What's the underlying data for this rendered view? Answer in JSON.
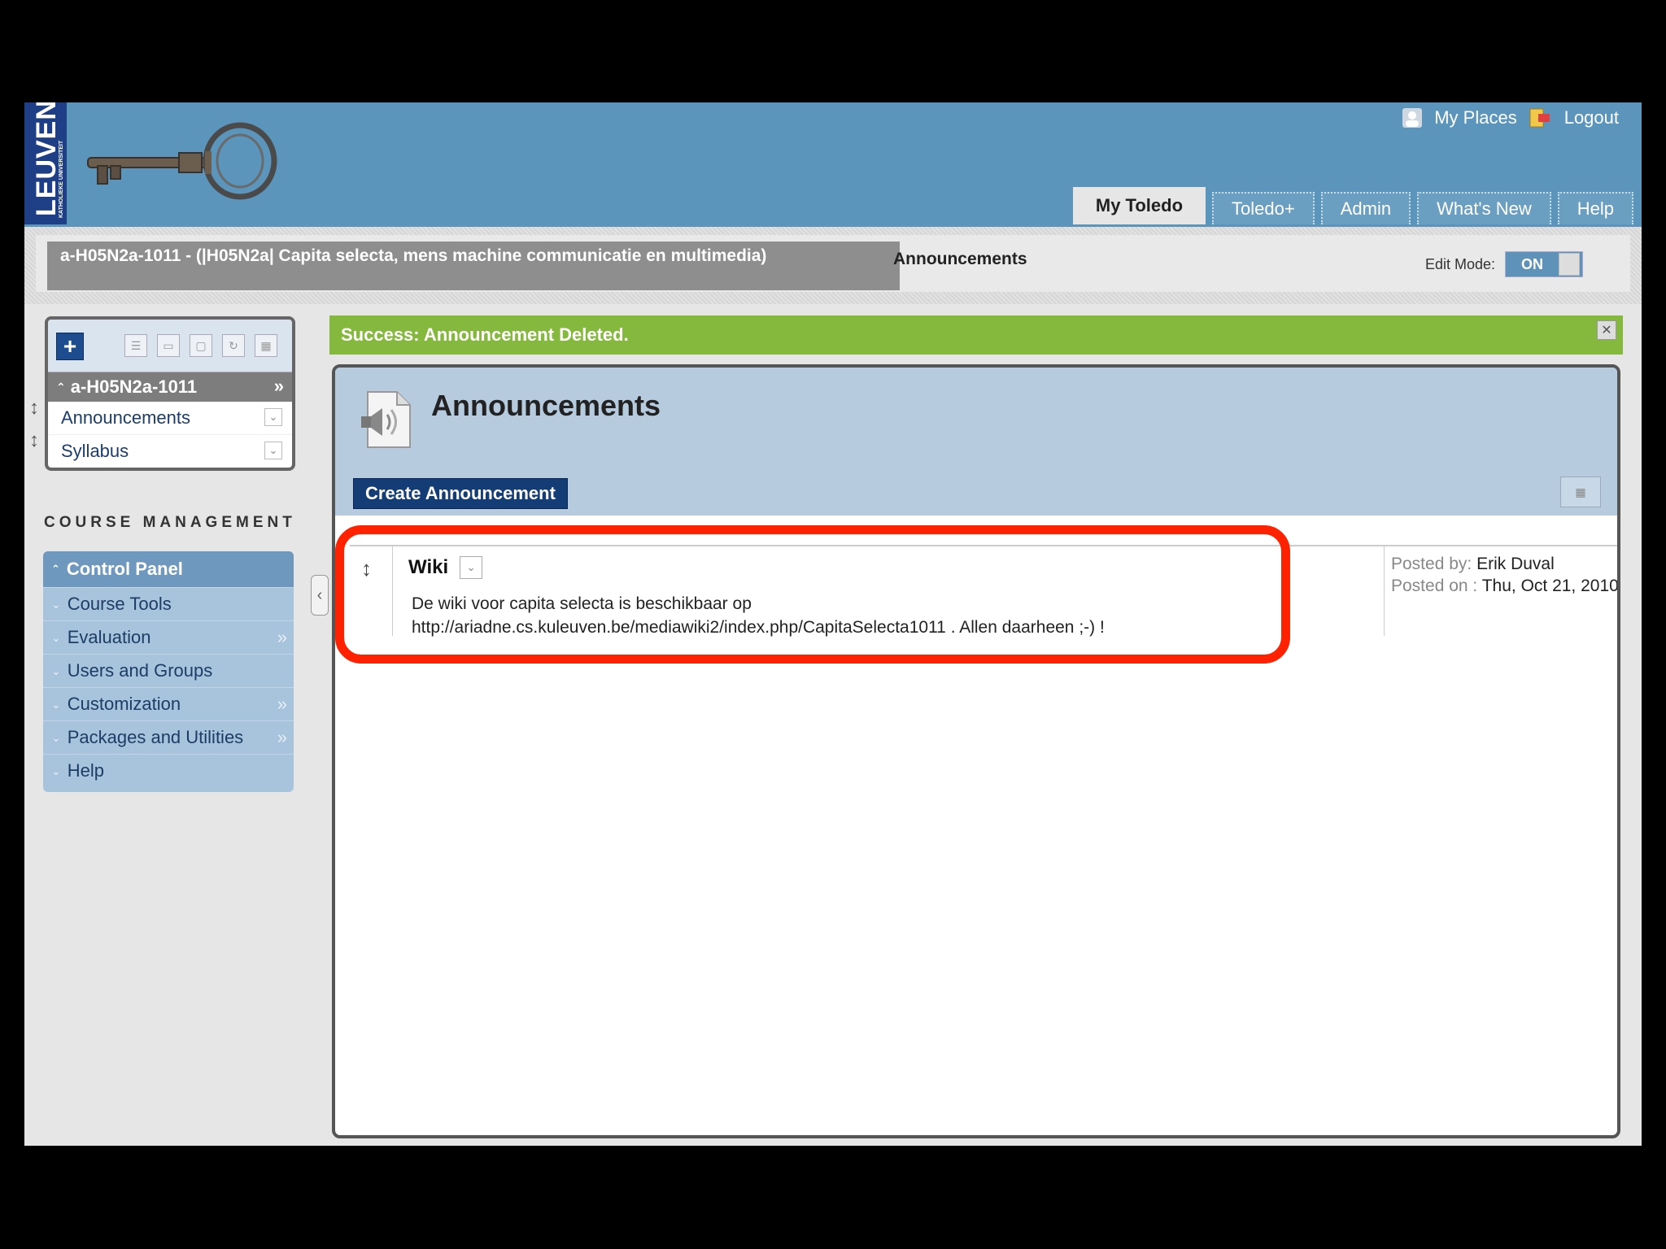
{
  "header": {
    "logo_text": "LEUVEN",
    "logo_subtext": "KATHOLIEKE UNIVERSITEIT",
    "my_places": "My Places",
    "logout": "Logout",
    "tabs": [
      {
        "label": "My Toledo",
        "active": true
      },
      {
        "label": "Toledo+",
        "active": false
      },
      {
        "label": "Admin",
        "active": false
      },
      {
        "label": "What's New",
        "active": false
      },
      {
        "label": "Help",
        "active": false
      }
    ]
  },
  "context": {
    "course_title": "a-H05N2a-1011 - (|H05N2a| Capita selecta, mens machine communicatie en multimedia)",
    "breadcrumb": "Announcements",
    "edit_mode_label": "Edit Mode:",
    "edit_mode_value": "ON"
  },
  "course_menu": {
    "course_id": "a-H05N2a-1011",
    "items": [
      {
        "label": "Announcements"
      },
      {
        "label": "Syllabus"
      }
    ]
  },
  "course_management": {
    "title": "COURSE MANAGEMENT",
    "control_panel": "Control Panel",
    "items": [
      {
        "label": "Course Tools"
      },
      {
        "label": "Evaluation"
      },
      {
        "label": "Users and Groups"
      },
      {
        "label": "Customization"
      },
      {
        "label": "Packages and Utilities"
      },
      {
        "label": "Help"
      }
    ]
  },
  "banner": {
    "message": "Success: Announcement Deleted."
  },
  "main": {
    "title": "Announcements",
    "create_button": "Create Announcement",
    "announcement": {
      "title": "Wiki",
      "body_line1": "De wiki voor capita selecta is beschikbaar op",
      "body_line2": "http://ariadne.cs.kuleuven.be/mediawiki2/index.php/CapitaSelecta1011 . Allen daarheen ;-) !",
      "posted_by_label": "Posted by:",
      "posted_by": "Erik Duval",
      "posted_on_label": "Posted on :",
      "posted_on": "Thu, Oct 21, 2010"
    }
  },
  "colors": {
    "header_blue": "#5b95bb",
    "success_green": "#84b93d",
    "highlight_red": "#ff2200",
    "button_navy": "#153d75"
  }
}
